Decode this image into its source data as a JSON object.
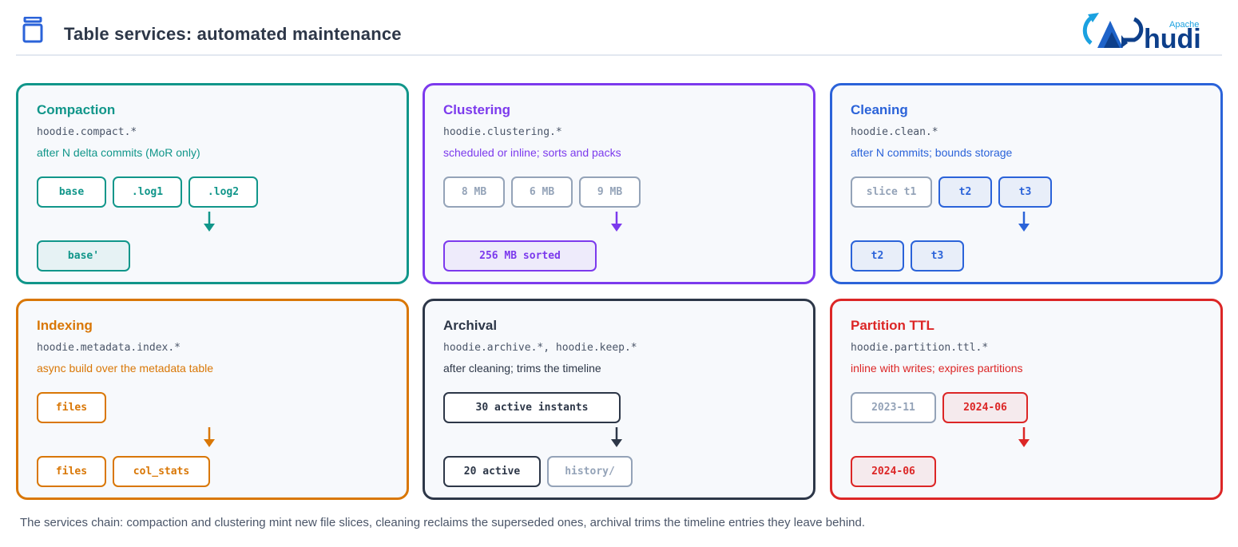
{
  "header": {
    "title": "Table services: automated maintenance",
    "logo_small": "Apache",
    "logo_text": "hudi"
  },
  "cards": [
    {
      "id": "compaction",
      "title": "Compaction",
      "config": "hoodie.compact.*",
      "desc": "after N delta commits (MoR only)",
      "color": "#11968a",
      "before": [
        "base",
        ".log1",
        ".log2"
      ],
      "after": [
        "base'"
      ]
    },
    {
      "id": "clustering",
      "title": "Clustering",
      "config": "hoodie.clustering.*",
      "desc": "scheduled or inline; sorts and packs",
      "color": "#7c3aed",
      "before": [
        "8 MB",
        "6 MB",
        "9 MB"
      ],
      "after": [
        "256 MB sorted"
      ]
    },
    {
      "id": "cleaning",
      "title": "Cleaning",
      "config": "hoodie.clean.*",
      "desc": "after N commits; bounds storage",
      "color": "#2b63d9",
      "before": [
        "slice t1",
        "t2",
        "t3"
      ],
      "after": [
        "t2",
        "t3"
      ]
    },
    {
      "id": "indexing",
      "title": "Indexing",
      "config": "hoodie.metadata.index.*",
      "desc": "async build over the metadata table",
      "color": "#d97706",
      "before": [
        "files"
      ],
      "after": [
        "files",
        "col_stats"
      ]
    },
    {
      "id": "archival",
      "title": "Archival",
      "config": "hoodie.archive.*, hoodie.keep.*",
      "desc": "after cleaning; trims the timeline",
      "color": "#2d3748",
      "before": [
        "30 active instants"
      ],
      "after": [
        "20 active",
        "history/"
      ]
    },
    {
      "id": "partition-ttl",
      "title": "Partition TTL",
      "config": "hoodie.partition.ttl.*",
      "desc": "inline with writes; expires partitions",
      "color": "#dc2626",
      "before": [
        "2023-11",
        "2024-06"
      ],
      "after": [
        "2024-06"
      ]
    }
  ],
  "footer": "The services chain: compaction and clustering mint new file slices, cleaning reclaims the superseded ones, archival trims the timeline entries they leave behind.",
  "colors": {
    "muted": "#94a3b8",
    "text": "#2d3748",
    "card_bg": "#f7f9fc"
  }
}
